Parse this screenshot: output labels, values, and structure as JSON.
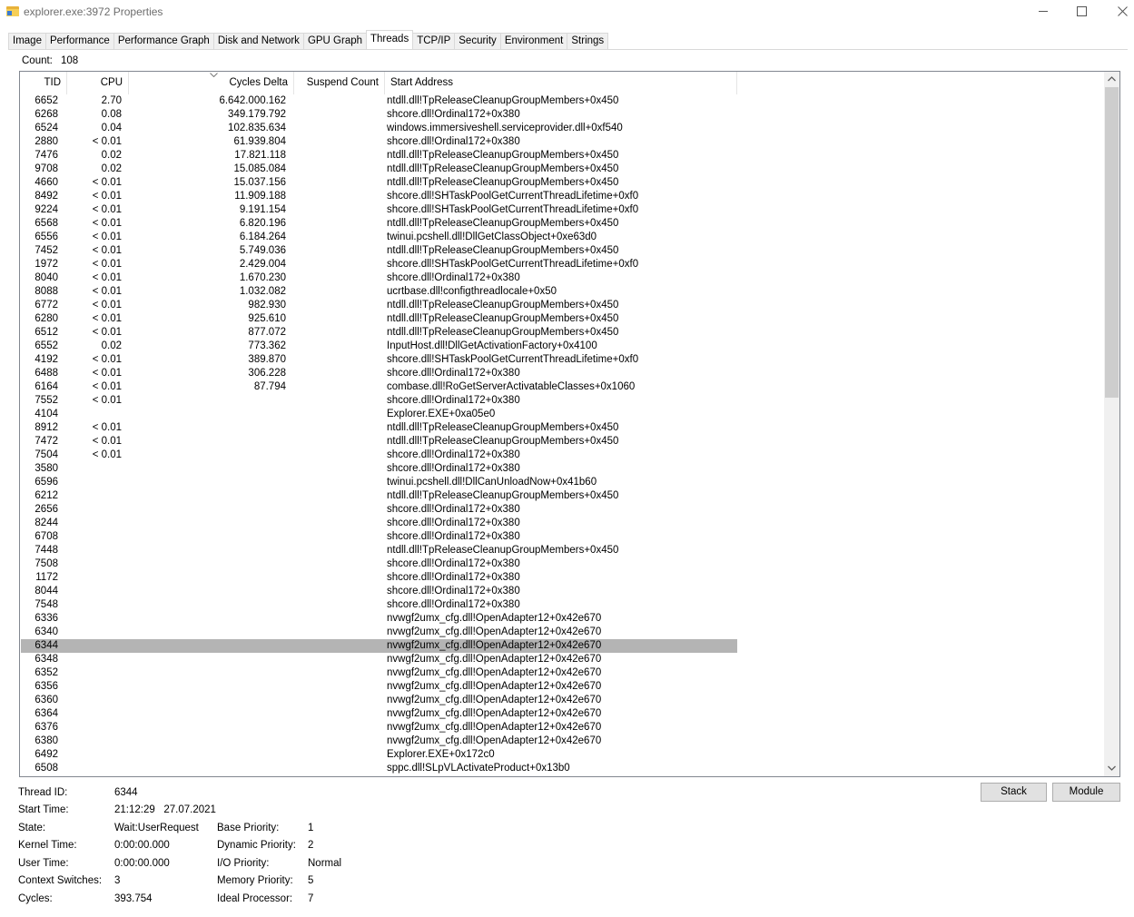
{
  "window": {
    "title": "explorer.exe:3972 Properties"
  },
  "tabs": [
    {
      "label": "Image",
      "active": false
    },
    {
      "label": "Performance",
      "active": false
    },
    {
      "label": "Performance Graph",
      "active": false
    },
    {
      "label": "Disk and Network",
      "active": false
    },
    {
      "label": "GPU Graph",
      "active": false
    },
    {
      "label": "Threads",
      "active": true
    },
    {
      "label": "TCP/IP",
      "active": false
    },
    {
      "label": "Security",
      "active": false
    },
    {
      "label": "Environment",
      "active": false
    },
    {
      "label": "Strings",
      "active": false
    }
  ],
  "count": {
    "label": "Count:",
    "value": "108"
  },
  "columns": {
    "tid": "TID",
    "cpu": "CPU",
    "cycles": "Cycles Delta",
    "suspend": "Suspend Count",
    "start": "Start Address"
  },
  "threads": [
    {
      "tid": "6652",
      "cpu": "2.70",
      "cycles": "6.642.000.162",
      "start": "ntdll.dll!TpReleaseCleanupGroupMembers+0x450"
    },
    {
      "tid": "6268",
      "cpu": "0.08",
      "cycles": "349.179.792",
      "start": "shcore.dll!Ordinal172+0x380"
    },
    {
      "tid": "6524",
      "cpu": "0.04",
      "cycles": "102.835.634",
      "start": "windows.immersiveshell.serviceprovider.dll+0xf540"
    },
    {
      "tid": "2880",
      "cpu": "< 0.01",
      "cycles": "61.939.804",
      "start": "shcore.dll!Ordinal172+0x380"
    },
    {
      "tid": "7476",
      "cpu": "0.02",
      "cycles": "17.821.118",
      "start": "ntdll.dll!TpReleaseCleanupGroupMembers+0x450"
    },
    {
      "tid": "9708",
      "cpu": "0.02",
      "cycles": "15.085.084",
      "start": "ntdll.dll!TpReleaseCleanupGroupMembers+0x450"
    },
    {
      "tid": "4660",
      "cpu": "< 0.01",
      "cycles": "15.037.156",
      "start": "ntdll.dll!TpReleaseCleanupGroupMembers+0x450"
    },
    {
      "tid": "8492",
      "cpu": "< 0.01",
      "cycles": "11.909.188",
      "start": "shcore.dll!SHTaskPoolGetCurrentThreadLifetime+0xf0"
    },
    {
      "tid": "9224",
      "cpu": "< 0.01",
      "cycles": "9.191.154",
      "start": "shcore.dll!SHTaskPoolGetCurrentThreadLifetime+0xf0"
    },
    {
      "tid": "6568",
      "cpu": "< 0.01",
      "cycles": "6.820.196",
      "start": "ntdll.dll!TpReleaseCleanupGroupMembers+0x450"
    },
    {
      "tid": "6556",
      "cpu": "< 0.01",
      "cycles": "6.184.264",
      "start": "twinui.pcshell.dll!DllGetClassObject+0xe63d0"
    },
    {
      "tid": "7452",
      "cpu": "< 0.01",
      "cycles": "5.749.036",
      "start": "ntdll.dll!TpReleaseCleanupGroupMembers+0x450"
    },
    {
      "tid": "1972",
      "cpu": "< 0.01",
      "cycles": "2.429.004",
      "start": "shcore.dll!SHTaskPoolGetCurrentThreadLifetime+0xf0"
    },
    {
      "tid": "8040",
      "cpu": "< 0.01",
      "cycles": "1.670.230",
      "start": "shcore.dll!Ordinal172+0x380"
    },
    {
      "tid": "8088",
      "cpu": "< 0.01",
      "cycles": "1.032.082",
      "start": "ucrtbase.dll!configthreadlocale+0x50"
    },
    {
      "tid": "6772",
      "cpu": "< 0.01",
      "cycles": "982.930",
      "start": "ntdll.dll!TpReleaseCleanupGroupMembers+0x450"
    },
    {
      "tid": "6280",
      "cpu": "< 0.01",
      "cycles": "925.610",
      "start": "ntdll.dll!TpReleaseCleanupGroupMembers+0x450"
    },
    {
      "tid": "6512",
      "cpu": "< 0.01",
      "cycles": "877.072",
      "start": "ntdll.dll!TpReleaseCleanupGroupMembers+0x450"
    },
    {
      "tid": "6552",
      "cpu": "0.02",
      "cycles": "773.362",
      "start": "InputHost.dll!DllGetActivationFactory+0x4100"
    },
    {
      "tid": "4192",
      "cpu": "< 0.01",
      "cycles": "389.870",
      "start": "shcore.dll!SHTaskPoolGetCurrentThreadLifetime+0xf0"
    },
    {
      "tid": "6488",
      "cpu": "< 0.01",
      "cycles": "306.228",
      "start": "shcore.dll!Ordinal172+0x380"
    },
    {
      "tid": "6164",
      "cpu": "< 0.01",
      "cycles": "87.794",
      "start": "combase.dll!RoGetServerActivatableClasses+0x1060"
    },
    {
      "tid": "7552",
      "cpu": "< 0.01",
      "cycles": "",
      "start": "shcore.dll!Ordinal172+0x380"
    },
    {
      "tid": "4104",
      "cpu": "",
      "cycles": "",
      "start": "Explorer.EXE+0xa05e0"
    },
    {
      "tid": "8912",
      "cpu": "< 0.01",
      "cycles": "",
      "start": "ntdll.dll!TpReleaseCleanupGroupMembers+0x450"
    },
    {
      "tid": "7472",
      "cpu": "< 0.01",
      "cycles": "",
      "start": "ntdll.dll!TpReleaseCleanupGroupMembers+0x450"
    },
    {
      "tid": "7504",
      "cpu": "< 0.01",
      "cycles": "",
      "start": "shcore.dll!Ordinal172+0x380"
    },
    {
      "tid": "3580",
      "cpu": "",
      "cycles": "",
      "start": "shcore.dll!Ordinal172+0x380"
    },
    {
      "tid": "6596",
      "cpu": "",
      "cycles": "",
      "start": "twinui.pcshell.dll!DllCanUnloadNow+0x41b60"
    },
    {
      "tid": "6212",
      "cpu": "",
      "cycles": "",
      "start": "ntdll.dll!TpReleaseCleanupGroupMembers+0x450"
    },
    {
      "tid": "2656",
      "cpu": "",
      "cycles": "",
      "start": "shcore.dll!Ordinal172+0x380"
    },
    {
      "tid": "8244",
      "cpu": "",
      "cycles": "",
      "start": "shcore.dll!Ordinal172+0x380"
    },
    {
      "tid": "6708",
      "cpu": "",
      "cycles": "",
      "start": "shcore.dll!Ordinal172+0x380"
    },
    {
      "tid": "7448",
      "cpu": "",
      "cycles": "",
      "start": "ntdll.dll!TpReleaseCleanupGroupMembers+0x450"
    },
    {
      "tid": "7508",
      "cpu": "",
      "cycles": "",
      "start": "shcore.dll!Ordinal172+0x380"
    },
    {
      "tid": "1172",
      "cpu": "",
      "cycles": "",
      "start": "shcore.dll!Ordinal172+0x380"
    },
    {
      "tid": "8044",
      "cpu": "",
      "cycles": "",
      "start": "shcore.dll!Ordinal172+0x380"
    },
    {
      "tid": "7548",
      "cpu": "",
      "cycles": "",
      "start": "shcore.dll!Ordinal172+0x380"
    },
    {
      "tid": "6336",
      "cpu": "",
      "cycles": "",
      "start": "nvwgf2umx_cfg.dll!OpenAdapter12+0x42e670"
    },
    {
      "tid": "6340",
      "cpu": "",
      "cycles": "",
      "start": "nvwgf2umx_cfg.dll!OpenAdapter12+0x42e670"
    },
    {
      "tid": "6344",
      "cpu": "",
      "cycles": "",
      "start": "nvwgf2umx_cfg.dll!OpenAdapter12+0x42e670",
      "selected": true
    },
    {
      "tid": "6348",
      "cpu": "",
      "cycles": "",
      "start": "nvwgf2umx_cfg.dll!OpenAdapter12+0x42e670"
    },
    {
      "tid": "6352",
      "cpu": "",
      "cycles": "",
      "start": "nvwgf2umx_cfg.dll!OpenAdapter12+0x42e670"
    },
    {
      "tid": "6356",
      "cpu": "",
      "cycles": "",
      "start": "nvwgf2umx_cfg.dll!OpenAdapter12+0x42e670"
    },
    {
      "tid": "6360",
      "cpu": "",
      "cycles": "",
      "start": "nvwgf2umx_cfg.dll!OpenAdapter12+0x42e670"
    },
    {
      "tid": "6364",
      "cpu": "",
      "cycles": "",
      "start": "nvwgf2umx_cfg.dll!OpenAdapter12+0x42e670"
    },
    {
      "tid": "6376",
      "cpu": "",
      "cycles": "",
      "start": "nvwgf2umx_cfg.dll!OpenAdapter12+0x42e670"
    },
    {
      "tid": "6380",
      "cpu": "",
      "cycles": "",
      "start": "nvwgf2umx_cfg.dll!OpenAdapter12+0x42e670"
    },
    {
      "tid": "6492",
      "cpu": "",
      "cycles": "",
      "start": "Explorer.EXE+0x172c0"
    },
    {
      "tid": "6508",
      "cpu": "",
      "cycles": "",
      "start": "sppc.dll!SLpVLActivateProduct+0x13b0"
    }
  ],
  "details": {
    "thread_id_label": "Thread ID:",
    "thread_id": "6344",
    "start_time_label": "Start Time:",
    "start_time": "21:12:29   27.07.2021",
    "state_label": "State:",
    "state": "Wait:UserRequest",
    "kernel_time_label": "Kernel Time:",
    "kernel_time": "0:00:00.000",
    "user_time_label": "User Time:",
    "user_time": "0:00:00.000",
    "context_switches_label": "Context Switches:",
    "context_switches": "3",
    "cycles_label": "Cycles:",
    "cycles": "393.754",
    "base_priority_label": "Base Priority:",
    "base_priority": "1",
    "dynamic_priority_label": "Dynamic Priority:",
    "dynamic_priority": "2",
    "io_priority_label": "I/O Priority:",
    "io_priority": "Normal",
    "memory_priority_label": "Memory Priority:",
    "memory_priority": "5",
    "ideal_processor_label": "Ideal Processor:",
    "ideal_processor": "7"
  },
  "buttons": {
    "stack": "Stack",
    "module": "Module"
  },
  "icons": {
    "app": "folder-icon",
    "minimize": "minimize-icon",
    "maximize": "maximize-icon",
    "close": "close-icon",
    "sort": "sort-desc-icon",
    "scroll_up": "scroll-up-icon",
    "scroll_down": "scroll-down-icon"
  },
  "colors": {
    "selection": "#b4b4b4",
    "title_text": "#6d6d6d"
  }
}
